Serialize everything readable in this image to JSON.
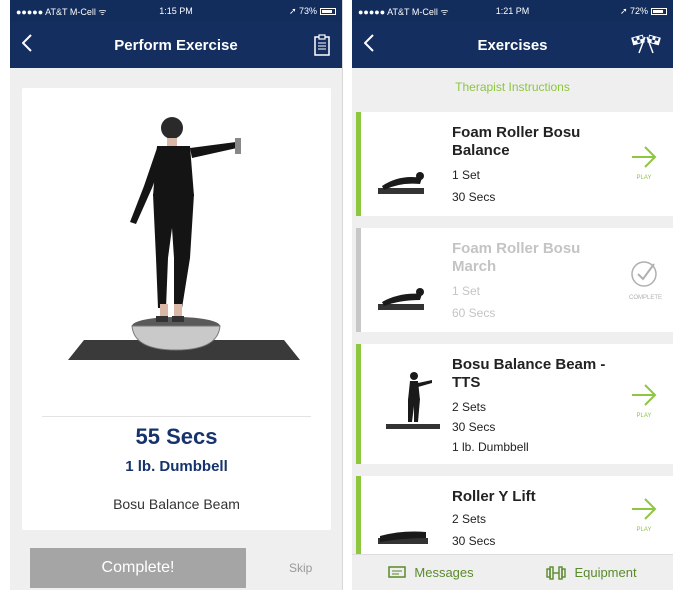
{
  "left": {
    "status": {
      "carrier": "●●●●● AT&T M-Cell ᯤ",
      "time": "1:15 PM",
      "battery": "➚ 73%"
    },
    "nav": {
      "title": "Perform Exercise",
      "back_icon": "chevron-left-icon",
      "right_icon": "clipboard-icon"
    },
    "card": {
      "duration": "55 Secs",
      "equipment": "1 lb. Dumbbell",
      "exercise_name": "Bosu Balance Beam"
    },
    "complete_label": "Complete!",
    "skip_label": "Skip"
  },
  "right": {
    "status": {
      "carrier": "●●●●● AT&T M-Cell ᯤ",
      "time": "1:21 PM",
      "battery": "➚ 72%"
    },
    "nav": {
      "title": "Exercises",
      "back_icon": "chevron-left-icon",
      "right_icon": "checkered-flags-icon"
    },
    "instructions_link": "Therapist Instructions",
    "items": [
      {
        "name": "Foam Roller Bosu Balance",
        "sets": "1 Set",
        "duration": "30 Secs",
        "equipment": "",
        "action": "PLAY",
        "state": "play"
      },
      {
        "name": "Foam Roller Bosu March",
        "sets": "1 Set",
        "duration": "60 Secs",
        "equipment": "",
        "action": "COMPLETE",
        "state": "complete"
      },
      {
        "name": "Bosu Balance Beam - TTS",
        "sets": "2 Sets",
        "duration": "30 Secs",
        "equipment": "1 lb. Dumbbell",
        "action": "PLAY",
        "state": "play"
      },
      {
        "name": "Roller Y Lift",
        "sets": "2 Sets",
        "duration": "30 Secs",
        "equipment": "",
        "action": "PLAY",
        "state": "play"
      }
    ],
    "tabs": {
      "messages": "Messages",
      "equipment": "Equipment"
    }
  },
  "colors": {
    "nav_blue": "#132e5f",
    "accent_green": "#8dc63f",
    "text_blue": "#16336b"
  }
}
